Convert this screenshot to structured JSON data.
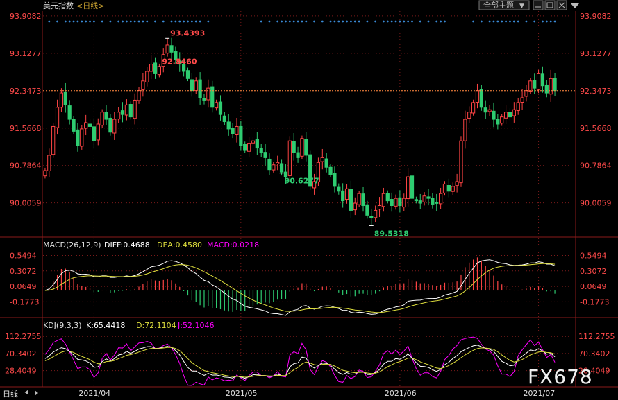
{
  "header": {
    "title": "美元指数",
    "period": "<日线>",
    "theme_button": "全部主题",
    "theme_arrow": "▼"
  },
  "colors": {
    "up": "#ff4444",
    "down": "#2ecc71",
    "price_label": "#ff4a4a",
    "macd_diff": "#ffffff",
    "macd_dea": "#dcdc3c",
    "macd_hist": "#ff00ff",
    "kdj_k": "#ffffff",
    "kdj_d": "#dcdc3c",
    "kdj_j": "#ff00ff",
    "dots": "#3a8ad6",
    "grid": "#7a1a1a",
    "last_line": "#ff8c40"
  },
  "icons": [
    "minimize-icon",
    "restore-icon",
    "close-icon",
    "expand-arrow-icon"
  ],
  "chart_data": [
    {
      "type": "candlestick",
      "title": "美元指数",
      "yaxis_ticks": [
        "93.9082",
        "93.1277",
        "92.3473",
        "91.5668",
        "90.7864",
        "90.0059"
      ],
      "ylim": [
        89.35,
        93.95
      ],
      "xaxis_ticks": [
        "2021/04",
        "2021/05",
        "2021/06",
        "2021/07"
      ],
      "annotations": [
        {
          "label": "93.4393",
          "value": 93.4393,
          "kind": "high"
        },
        {
          "label": "90.6277",
          "value": 90.6277,
          "kind": "low"
        },
        {
          "label": "89.5318",
          "value": 89.5318,
          "kind": "low"
        },
        {
          "label": "92.8460",
          "value": 92.846,
          "kind": "high"
        }
      ],
      "last_value": 92.3473,
      "closes": [
        90.68,
        91.0,
        91.6,
        92.0,
        92.3,
        92.05,
        91.75,
        91.5,
        91.2,
        91.55,
        91.68,
        91.6,
        91.3,
        91.65,
        91.9,
        91.75,
        91.48,
        91.75,
        91.9,
        91.85,
        92.05,
        91.8,
        92.15,
        92.35,
        92.55,
        92.75,
        92.9,
        92.7,
        92.85,
        93.1,
        93.3,
        93.15,
        93.0,
        92.9,
        92.75,
        92.6,
        92.35,
        92.55,
        92.2,
        92.15,
        92.4,
        92.0,
        92.1,
        91.85,
        91.7,
        91.55,
        91.45,
        91.6,
        91.2,
        91.1,
        91.25,
        91.3,
        91.15,
        91.05,
        90.95,
        90.7,
        90.8,
        90.85,
        90.65,
        90.55,
        91.3,
        91.05,
        90.95,
        91.35,
        91.0,
        90.35,
        90.45,
        90.85,
        90.95,
        90.75,
        90.6,
        90.35,
        90.25,
        90.05,
        90.3,
        89.85,
        90.0,
        90.2,
        89.95,
        89.75,
        89.7,
        89.85,
        89.95,
        90.2,
        90.05,
        89.95,
        90.1,
        89.95,
        90.1,
        90.55,
        90.1,
        90.05,
        90.0,
        90.15,
        90.1,
        89.98,
        90.0,
        90.2,
        90.4,
        90.25,
        90.35,
        90.45,
        91.3,
        91.75,
        91.9,
        92.1,
        92.35,
        92.0,
        91.9,
        91.95,
        91.75,
        91.65,
        91.8,
        91.9,
        91.8,
        91.95,
        92.1,
        92.2,
        92.35,
        92.55,
        92.4,
        92.7,
        92.45,
        92.3,
        92.6,
        92.35
      ],
      "macd": {
        "label": "MACD(26,12,9)",
        "diff_label": "DIFF:0.4688",
        "dea_label": "DEA:0.4580",
        "macd_label": "MACD:0.0218",
        "yaxis_ticks": [
          "0.5494",
          "0.3072",
          "0.0649",
          "-0.1773"
        ],
        "ylim": [
          -0.38,
          0.62
        ]
      },
      "kdj": {
        "label": "KDJ(9,3,3)",
        "k_label": "K:65.4418",
        "d_label": "D:72.1104",
        "j_label": "J:52.1046",
        "yaxis_ticks": [
          "112.2755",
          "70.3402",
          "28.4049"
        ],
        "ylim": [
          -8,
          128
        ]
      }
    }
  ],
  "footer": {
    "period": "日线",
    "watermark": "FX678"
  }
}
